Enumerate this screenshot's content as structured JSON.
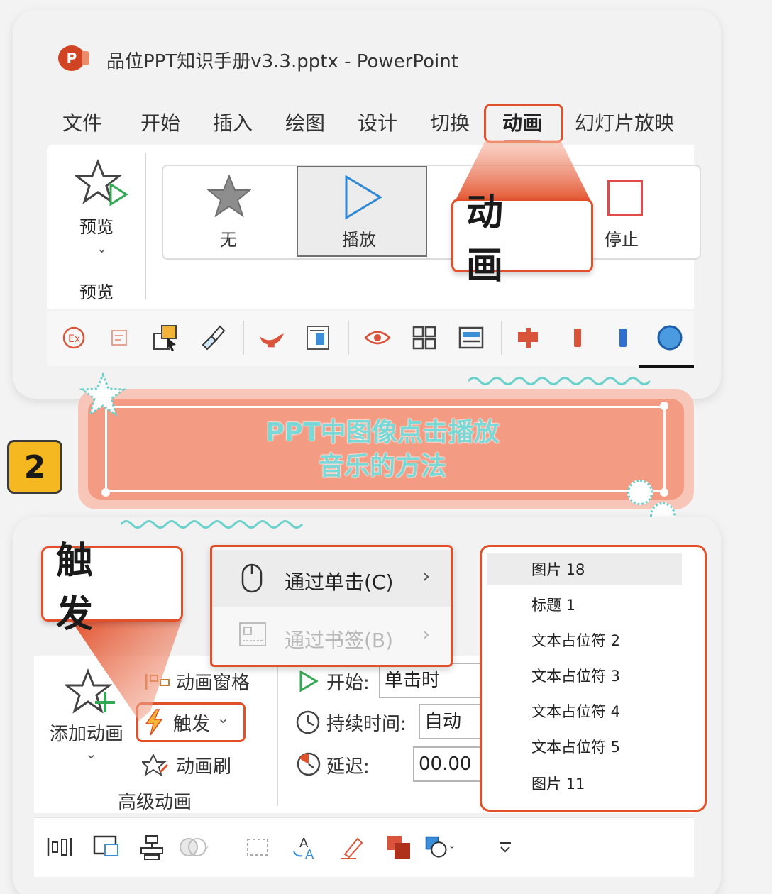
{
  "top_window": {
    "logo_letter": "P",
    "title": "品位PPT知识手册v3.3.pptx  -  PowerPoint",
    "tabs": [
      "文件",
      "开始",
      "插入",
      "绘图",
      "设计",
      "切换",
      "动画",
      "幻灯片放映"
    ],
    "active_tab": "动画",
    "preview": {
      "button_label": "预览",
      "caret": "⌄",
      "group_label": "预览"
    },
    "gallery": {
      "none_label": "无",
      "play_label": "播放",
      "stop_label": "停止"
    },
    "callout": "动 画",
    "accent_color": "#e2502a"
  },
  "banner": {
    "step_number": "2",
    "line1": "PPT中图像点击播放",
    "line2": "音乐的方法",
    "text_color": "#7ad9d6",
    "fill_color": "#f39c83"
  },
  "bottom_window": {
    "callout": "触 发",
    "trigger_menu": {
      "item_click": {
        "label": "通过单击(C)",
        "arrow": "›"
      },
      "item_bookmark": {
        "label": "通过书签(B)",
        "arrow": "›"
      }
    },
    "shape_list": [
      "图片 18",
      "标题 1",
      "文本占位符 2",
      "文本占位符 3",
      "文本占位符 4",
      "文本占位符 5",
      "图片 11"
    ],
    "advanced": {
      "add_animation": "添加动画",
      "add_caret": "⌄",
      "animation_pane": "动画窗格",
      "trigger": "触发",
      "trigger_caret": "⌄",
      "painter": "动画刷",
      "group_label": "高级动画"
    },
    "timing": {
      "start_label": "开始:",
      "start_value": "单击时",
      "duration_label": "持续时间:",
      "duration_value": "自动",
      "delay_label": "延迟:",
      "delay_value": "00.00"
    }
  }
}
